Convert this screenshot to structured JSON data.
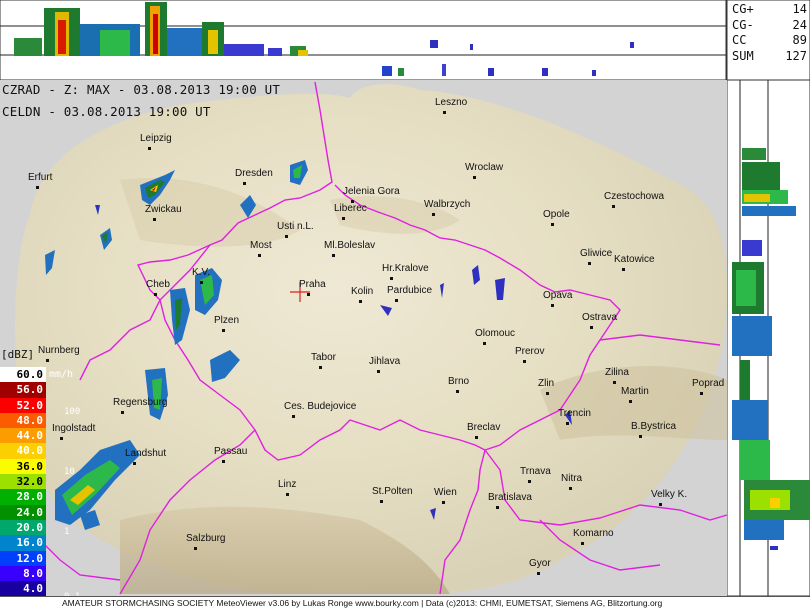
{
  "header": {
    "line1": "CZRAD - Z: MAX - 03.08.2013 19:00 UT",
    "line2": "CELDN - 03.08.2013 19:00 UT"
  },
  "lightning_stats": [
    {
      "label": "CG+",
      "value": "14"
    },
    {
      "label": "CG-",
      "value": "24"
    },
    {
      "label": "CC",
      "value": "89"
    },
    {
      "label": "SUM",
      "value": "127"
    }
  ],
  "legend": {
    "title": "[dBZ]",
    "unit": "mm/h",
    "entries": [
      {
        "value": "60.0",
        "color": "#ffffff",
        "text": "#000000"
      },
      {
        "value": "56.0",
        "color": "#a00000",
        "text": "#ffffff"
      },
      {
        "value": "52.0",
        "color": "#fc0000",
        "text": "#ffffff"
      },
      {
        "value": "48.0",
        "color": "#fc5c00",
        "text": "#ffffff"
      },
      {
        "value": "44.0",
        "color": "#fc9c00",
        "text": "#ffffff"
      },
      {
        "value": "40.0",
        "color": "#fcd000",
        "text": "#ffffff"
      },
      {
        "value": "36.0",
        "color": "#fcfc00",
        "text": "#000000"
      },
      {
        "value": "32.0",
        "color": "#9ce000",
        "text": "#000000"
      },
      {
        "value": "28.0",
        "color": "#00b000",
        "text": "#ffffff"
      },
      {
        "value": "24.0",
        "color": "#009000",
        "text": "#ffffff"
      },
      {
        "value": "20.0",
        "color": "#00a86c",
        "text": "#ffffff"
      },
      {
        "value": "16.0",
        "color": "#0084cc",
        "text": "#ffffff"
      },
      {
        "value": "12.0",
        "color": "#0040fc",
        "text": "#ffffff"
      },
      {
        "value": "8.0",
        "color": "#3800fc",
        "text": "#ffffff"
      },
      {
        "value": "4.0",
        "color": "#1800a0",
        "text": "#ffffff"
      }
    ],
    "rain_labels": [
      "100",
      "10",
      "1",
      "0.1"
    ]
  },
  "cities": [
    {
      "name": "Leszno"
    },
    {
      "name": "Leipzig"
    },
    {
      "name": "Wroclaw"
    },
    {
      "name": "Erfurt"
    },
    {
      "name": "Dresden"
    },
    {
      "name": "Jelenia Gora"
    },
    {
      "name": "Walbrzych"
    },
    {
      "name": "Czestochowa"
    },
    {
      "name": "Zwickau"
    },
    {
      "name": "Liberec"
    },
    {
      "name": "Opole"
    },
    {
      "name": "Usti n.L."
    },
    {
      "name": "Most"
    },
    {
      "name": "Ml.Boleslav"
    },
    {
      "name": "Gliwice"
    },
    {
      "name": "Katowice"
    },
    {
      "name": "K.V."
    },
    {
      "name": "Praha"
    },
    {
      "name": "Hr.Kralove"
    },
    {
      "name": "Cheb"
    },
    {
      "name": "Kolin"
    },
    {
      "name": "Pardubice"
    },
    {
      "name": "Opava"
    },
    {
      "name": "Plzen"
    },
    {
      "name": "Ostrava"
    },
    {
      "name": "Olomouc"
    },
    {
      "name": "Nurnberg"
    },
    {
      "name": "Prerov"
    },
    {
      "name": "Tabor"
    },
    {
      "name": "Jihlava"
    },
    {
      "name": "Zilina"
    },
    {
      "name": "Poprad"
    },
    {
      "name": "Brno"
    },
    {
      "name": "Zlin"
    },
    {
      "name": "Martin"
    },
    {
      "name": "Regensburg"
    },
    {
      "name": "Ces. Budejovice"
    },
    {
      "name": "Trencin"
    },
    {
      "name": "Ingolstadt"
    },
    {
      "name": "Breclav"
    },
    {
      "name": "B.Bystrica"
    },
    {
      "name": "Passau"
    },
    {
      "name": "Landshut"
    },
    {
      "name": "Trnava"
    },
    {
      "name": "Nitra"
    },
    {
      "name": "Linz"
    },
    {
      "name": "St.Polten"
    },
    {
      "name": "Wien"
    },
    {
      "name": "Bratislava"
    },
    {
      "name": "Velky K."
    },
    {
      "name": "Salzburg"
    },
    {
      "name": "Komarno"
    },
    {
      "name": "Gyor"
    }
  ],
  "footer": "AMATEUR STORMCHASING SOCIETY MeteoViewer v3.06 by Lukas Ronge www.bourky.com | Data (c)2013: CHMI, EUMETSAT, Siemens AG, Blitzortung.org"
}
